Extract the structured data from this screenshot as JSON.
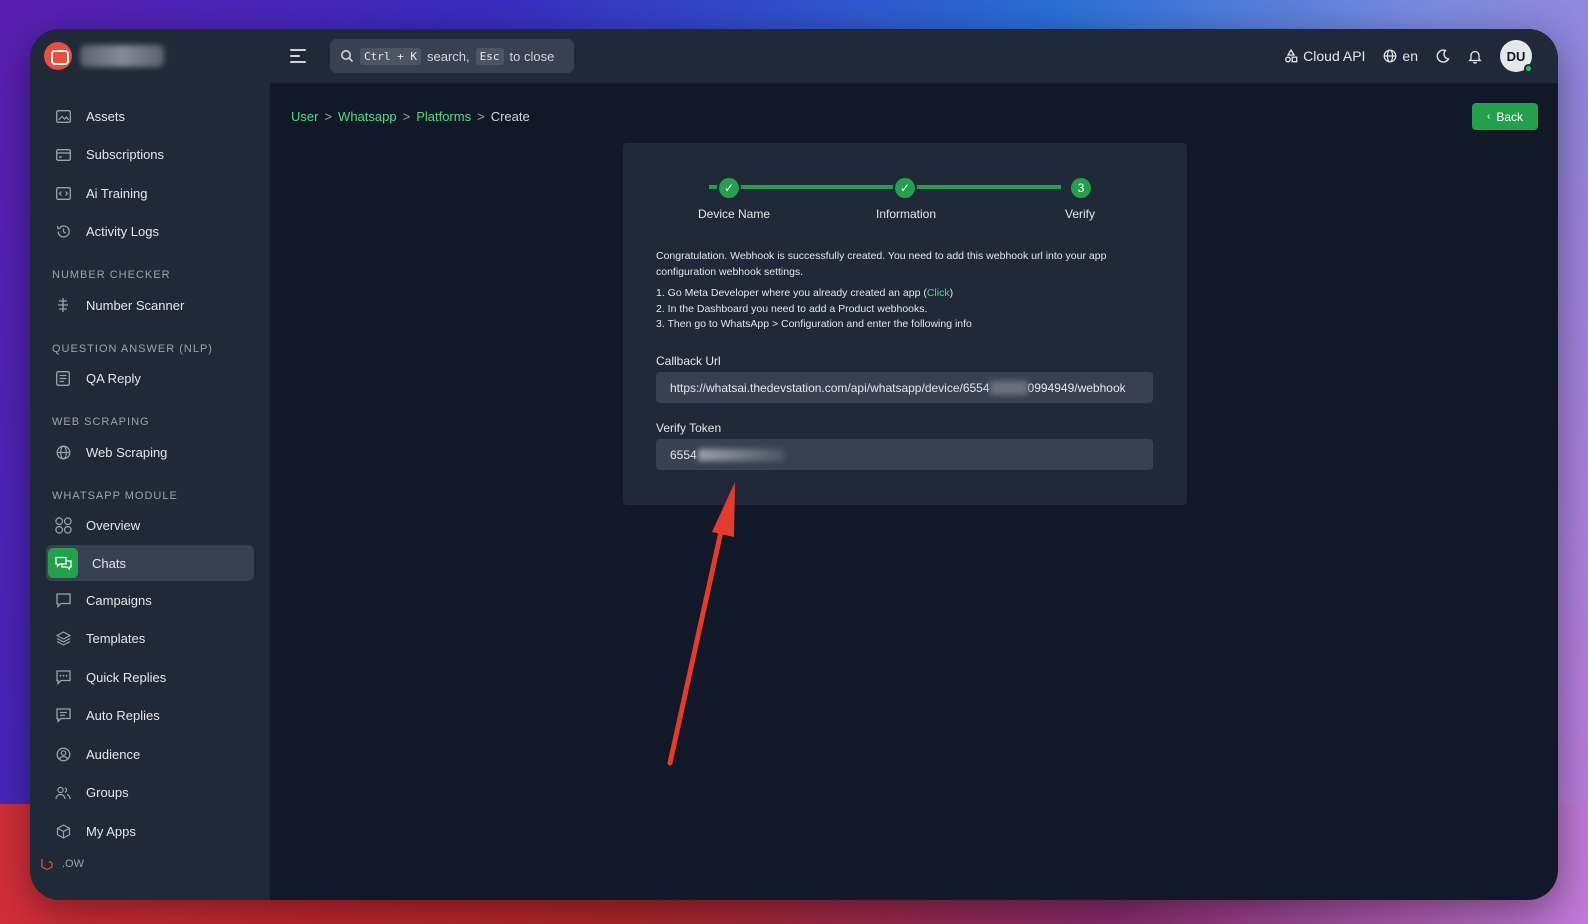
{
  "topbar": {
    "search_hint_key1": "Ctrl + K",
    "search_hint_text1": "search,",
    "search_hint_key2": "Esc",
    "search_hint_text2": "to close",
    "cloud_api": "Cloud API",
    "language": "en",
    "avatar_initials": "DU"
  },
  "sidebar": {
    "items": [
      {
        "label": "Assets",
        "icon": "image-icon"
      },
      {
        "label": "Subscriptions",
        "icon": "card-icon"
      },
      {
        "label": "Ai Training",
        "icon": "code-icon"
      },
      {
        "label": "Activity Logs",
        "icon": "history-icon"
      }
    ],
    "section_number_checker": "NUMBER CHECKER",
    "number_scanner": "Number Scanner",
    "section_qa": "QUESTION ANSWER (NLP)",
    "qa_reply": "QA Reply",
    "section_web": "WEB SCRAPING",
    "web_scraping": "Web Scraping",
    "section_whatsapp": "WHATSAPP MODULE",
    "wa_items": [
      {
        "label": "Overview"
      },
      {
        "label": "Chats"
      },
      {
        "label": "Campaigns"
      },
      {
        "label": "Templates"
      },
      {
        "label": "Quick Replies"
      },
      {
        "label": "Auto Replies"
      },
      {
        "label": "Audience"
      },
      {
        "label": "Groups"
      },
      {
        "label": "My Apps"
      }
    ],
    "footer_text": ".OW"
  },
  "breadcrumb": {
    "user": "User",
    "whatsapp": "Whatsapp",
    "platforms": "Platforms",
    "current": "Create",
    "sep": ">"
  },
  "back_button": "Back",
  "stepper": {
    "steps": [
      {
        "label": "Device Name",
        "state": "done",
        "mark": "✓"
      },
      {
        "label": "Information",
        "state": "done",
        "mark": "✓"
      },
      {
        "label": "Verify",
        "state": "current",
        "mark": "3"
      }
    ]
  },
  "message": {
    "intro": "Congratulation. Webhook is successfully created. You need to add this webhook url into your app configuration webhook settings.",
    "step1_pre": "1. Go Meta Developer where you already created an app (",
    "step1_link": "Click",
    "step1_post": ")",
    "step2": "2. In the Dashboard you need to add a Product webhooks.",
    "step3": "3. Then go to WhatsApp > Configuration and enter the following info"
  },
  "callback": {
    "label": "Callback Url",
    "value_start": "https://whatsai.thedevstation.com/api/whatsapp/device/6554",
    "value_end": "0994949/webhook"
  },
  "token": {
    "label": "Verify Token",
    "value_start": "6554"
  },
  "colors": {
    "accent": "#22a04b",
    "link": "#4ade80",
    "annotation_arrow": "#e53b2c"
  }
}
